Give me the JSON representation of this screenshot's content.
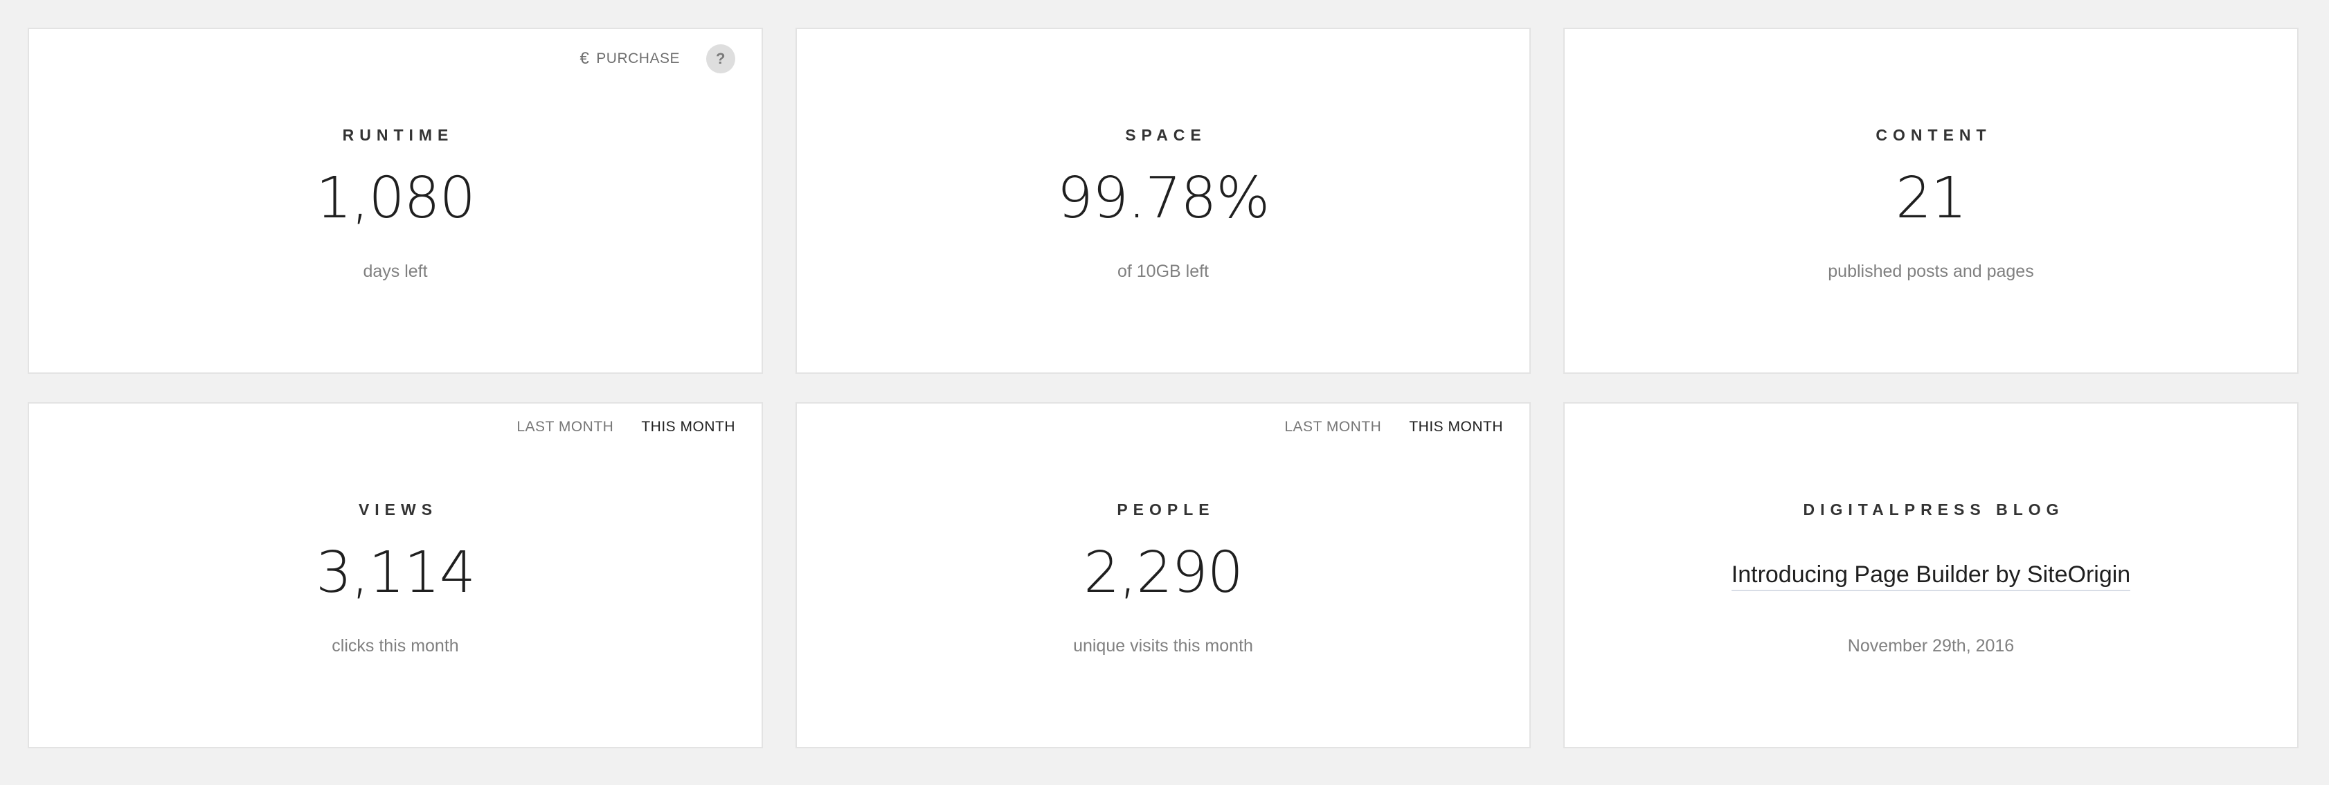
{
  "runtime": {
    "purchase_label": "PURCHASE",
    "help_label": "?",
    "label": "RUNTIME",
    "value": "1,080",
    "sub": "days left"
  },
  "space": {
    "label": "SPACE",
    "value": "99.78%",
    "sub": "of 10GB left"
  },
  "content": {
    "label": "CONTENT",
    "value": "21",
    "sub": "published posts and pages"
  },
  "views": {
    "range_last": "LAST MONTH",
    "range_this": "THIS MONTH",
    "label": "VIEWS",
    "value": "3,114",
    "sub": "clicks this month"
  },
  "people": {
    "range_last": "LAST MONTH",
    "range_this": "THIS MONTH",
    "label": "PEOPLE",
    "value": "2,290",
    "sub": "unique visits this month"
  },
  "blog": {
    "label": "DIGITALPRESS BLOG",
    "post_title": "Introducing Page Builder by SiteOrigin",
    "post_date": "November 29th, 2016"
  },
  "icons": {
    "purchase": "euro-icon",
    "help": "question-icon"
  },
  "colors": {
    "background": "#f1f1f1",
    "card": "#ffffff",
    "card_border": "#e3e3e3",
    "muted_text": "#808080",
    "active_range": "#222222"
  }
}
